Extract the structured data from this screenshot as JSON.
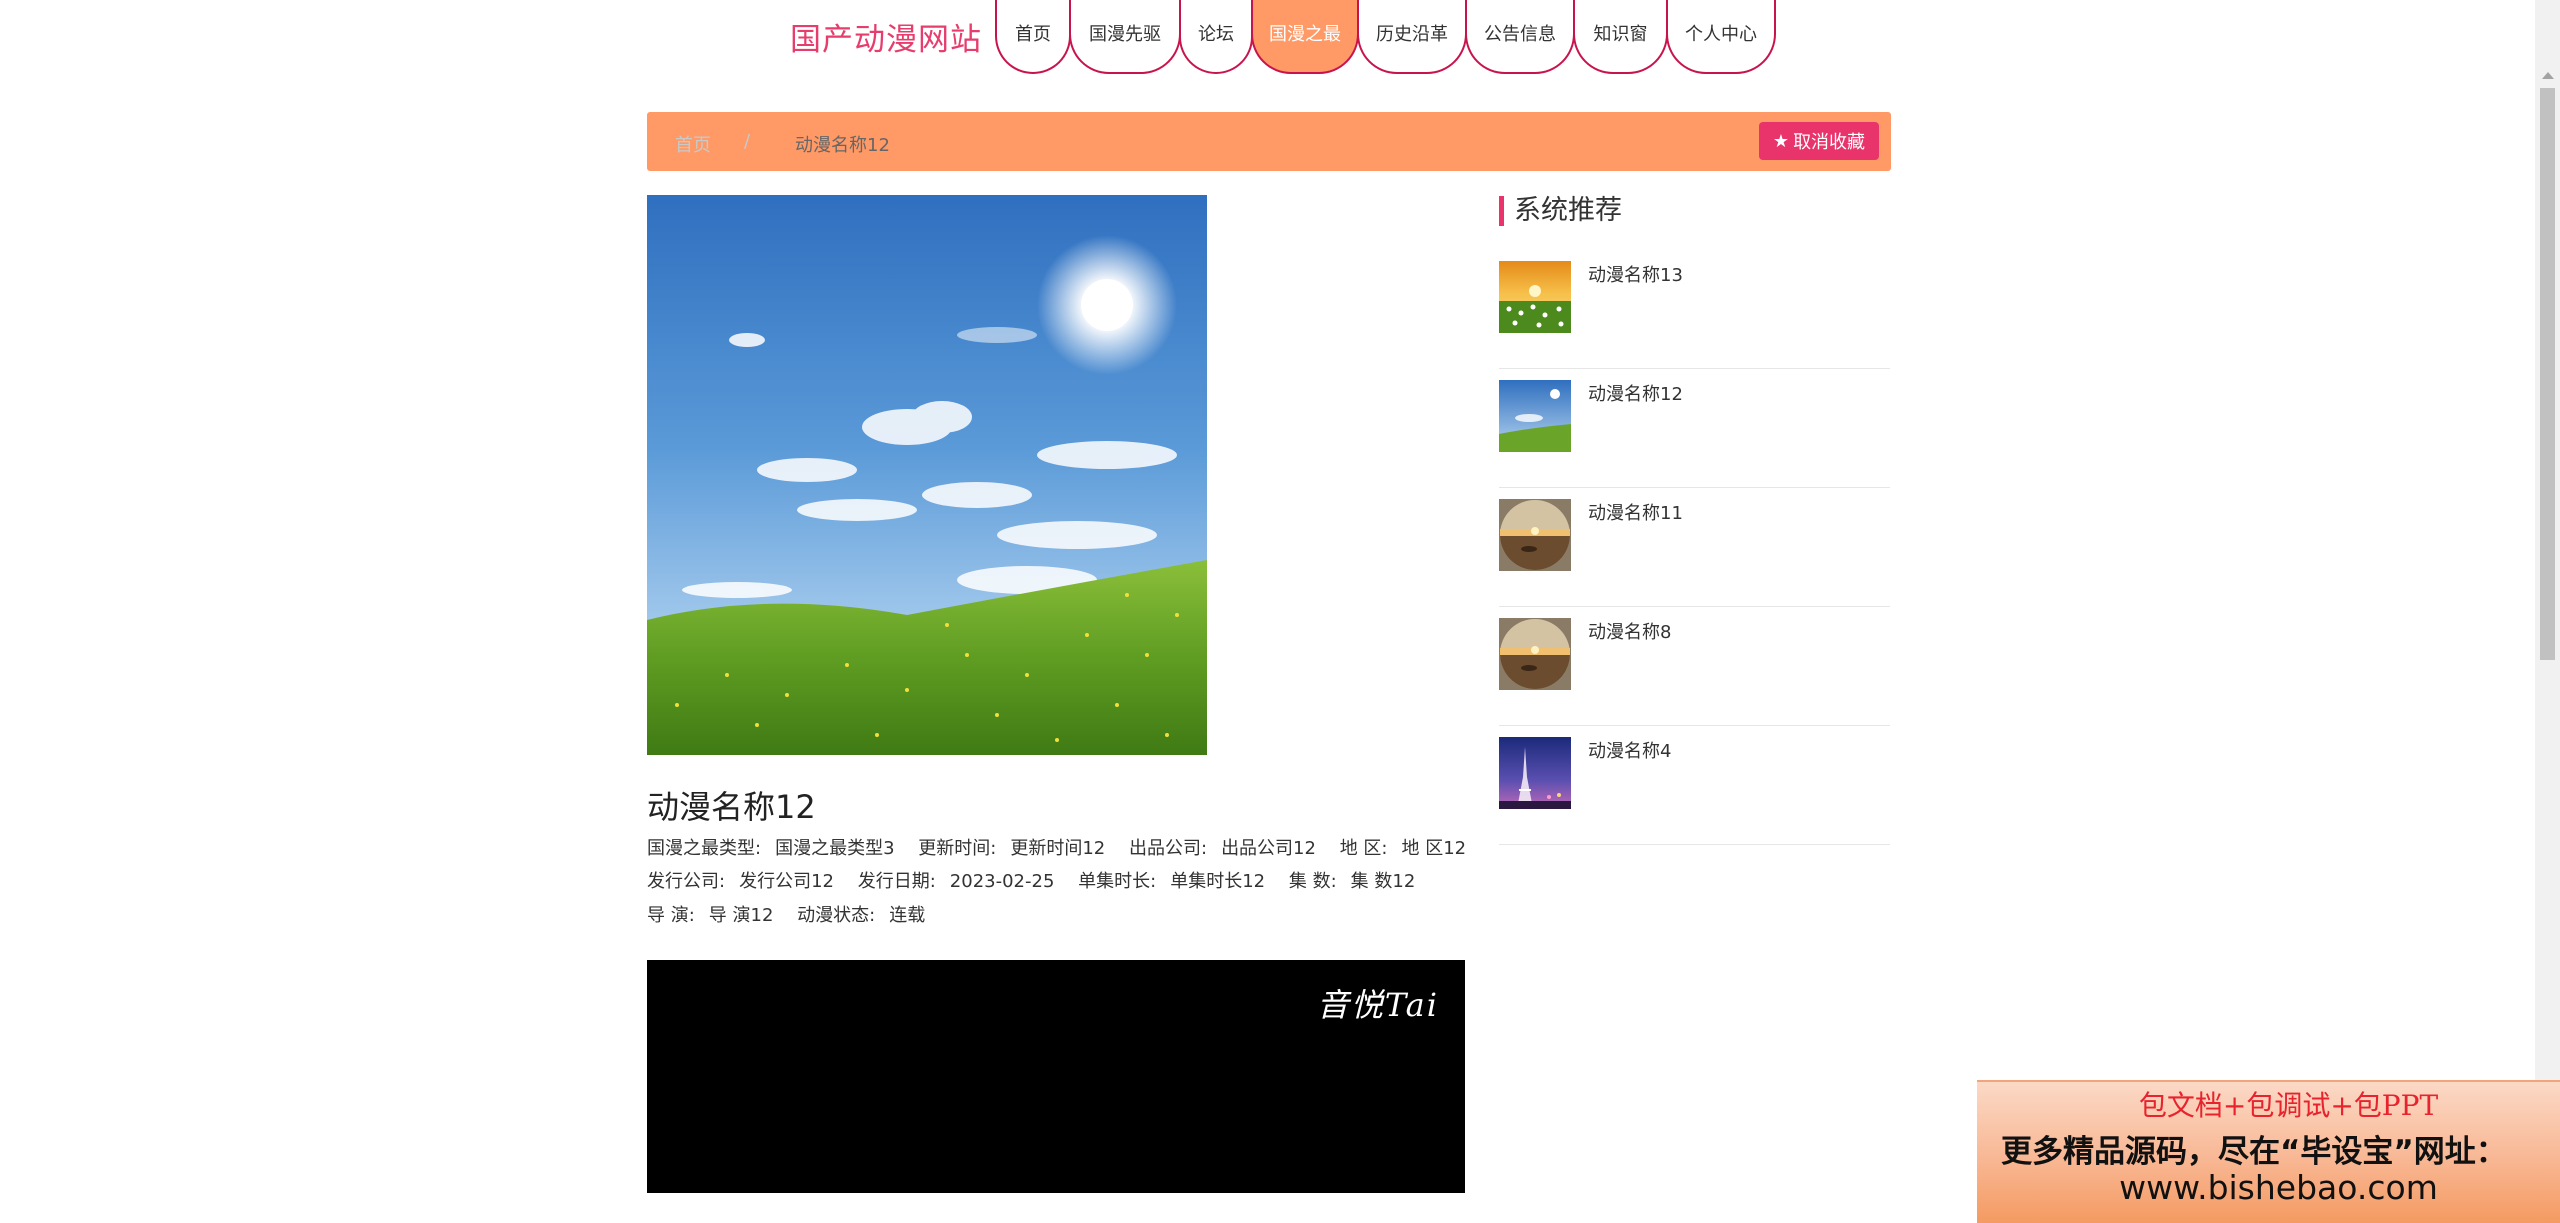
{
  "header": {
    "site_title": "国产动漫网站",
    "nav": [
      {
        "label": "首页",
        "active": false
      },
      {
        "label": "国漫先驱",
        "active": false
      },
      {
        "label": "论坛",
        "active": false
      },
      {
        "label": "国漫之最",
        "active": true
      },
      {
        "label": "历史沿革",
        "active": false
      },
      {
        "label": "公告信息",
        "active": false
      },
      {
        "label": "知识窗",
        "active": false
      },
      {
        "label": "个人中心",
        "active": false
      }
    ]
  },
  "breadcrumb": {
    "home": "首页",
    "separator": "/",
    "current": "动漫名称12",
    "favorite_button": "取消收藏",
    "favorite_icon": "star-icon"
  },
  "detail": {
    "title": "动漫名称12",
    "image": "grassland-sky-photo",
    "line1": [
      {
        "k": "国漫之最类型:",
        "v": "国漫之最类型3"
      },
      {
        "k": "更新时间:",
        "v": "更新时间12"
      },
      {
        "k": "出品公司:",
        "v": "出品公司12"
      },
      {
        "k": "地 区:",
        "v": "地 区12"
      }
    ],
    "line2": [
      {
        "k": "发行公司:",
        "v": "发行公司12"
      },
      {
        "k": "发行日期:",
        "v": "2023-02-25"
      },
      {
        "k": "单集时长:",
        "v": "单集时长12"
      },
      {
        "k": "集 数:",
        "v": "集 数12"
      }
    ],
    "line3": [
      {
        "k": "导 演:",
        "v": "导 演12"
      },
      {
        "k": "动漫状态:",
        "v": "连载"
      }
    ],
    "video_watermark": "音悦Tai"
  },
  "sidebar": {
    "heading": "系统推荐",
    "items": [
      {
        "name": "动漫名称13",
        "thumb": "sunset-flowers"
      },
      {
        "name": "动漫名称12",
        "thumb": "grassland-sky"
      },
      {
        "name": "动漫名称11",
        "thumb": "desert-sphere"
      },
      {
        "name": "动漫名称8",
        "thumb": "desert-sphere"
      },
      {
        "name": "动漫名称4",
        "thumb": "eiffel-tower-night"
      }
    ]
  },
  "ad": {
    "line1": "包文档+包调试+包PPT",
    "line2": "更多精品源码，尽在“毕设宝”网址：",
    "line3": "www.bishebao.com"
  },
  "colors": {
    "brand": "#e63d6d",
    "nav_border": "#c8144c",
    "accent": "#ff9966",
    "button": "#e8336b"
  }
}
